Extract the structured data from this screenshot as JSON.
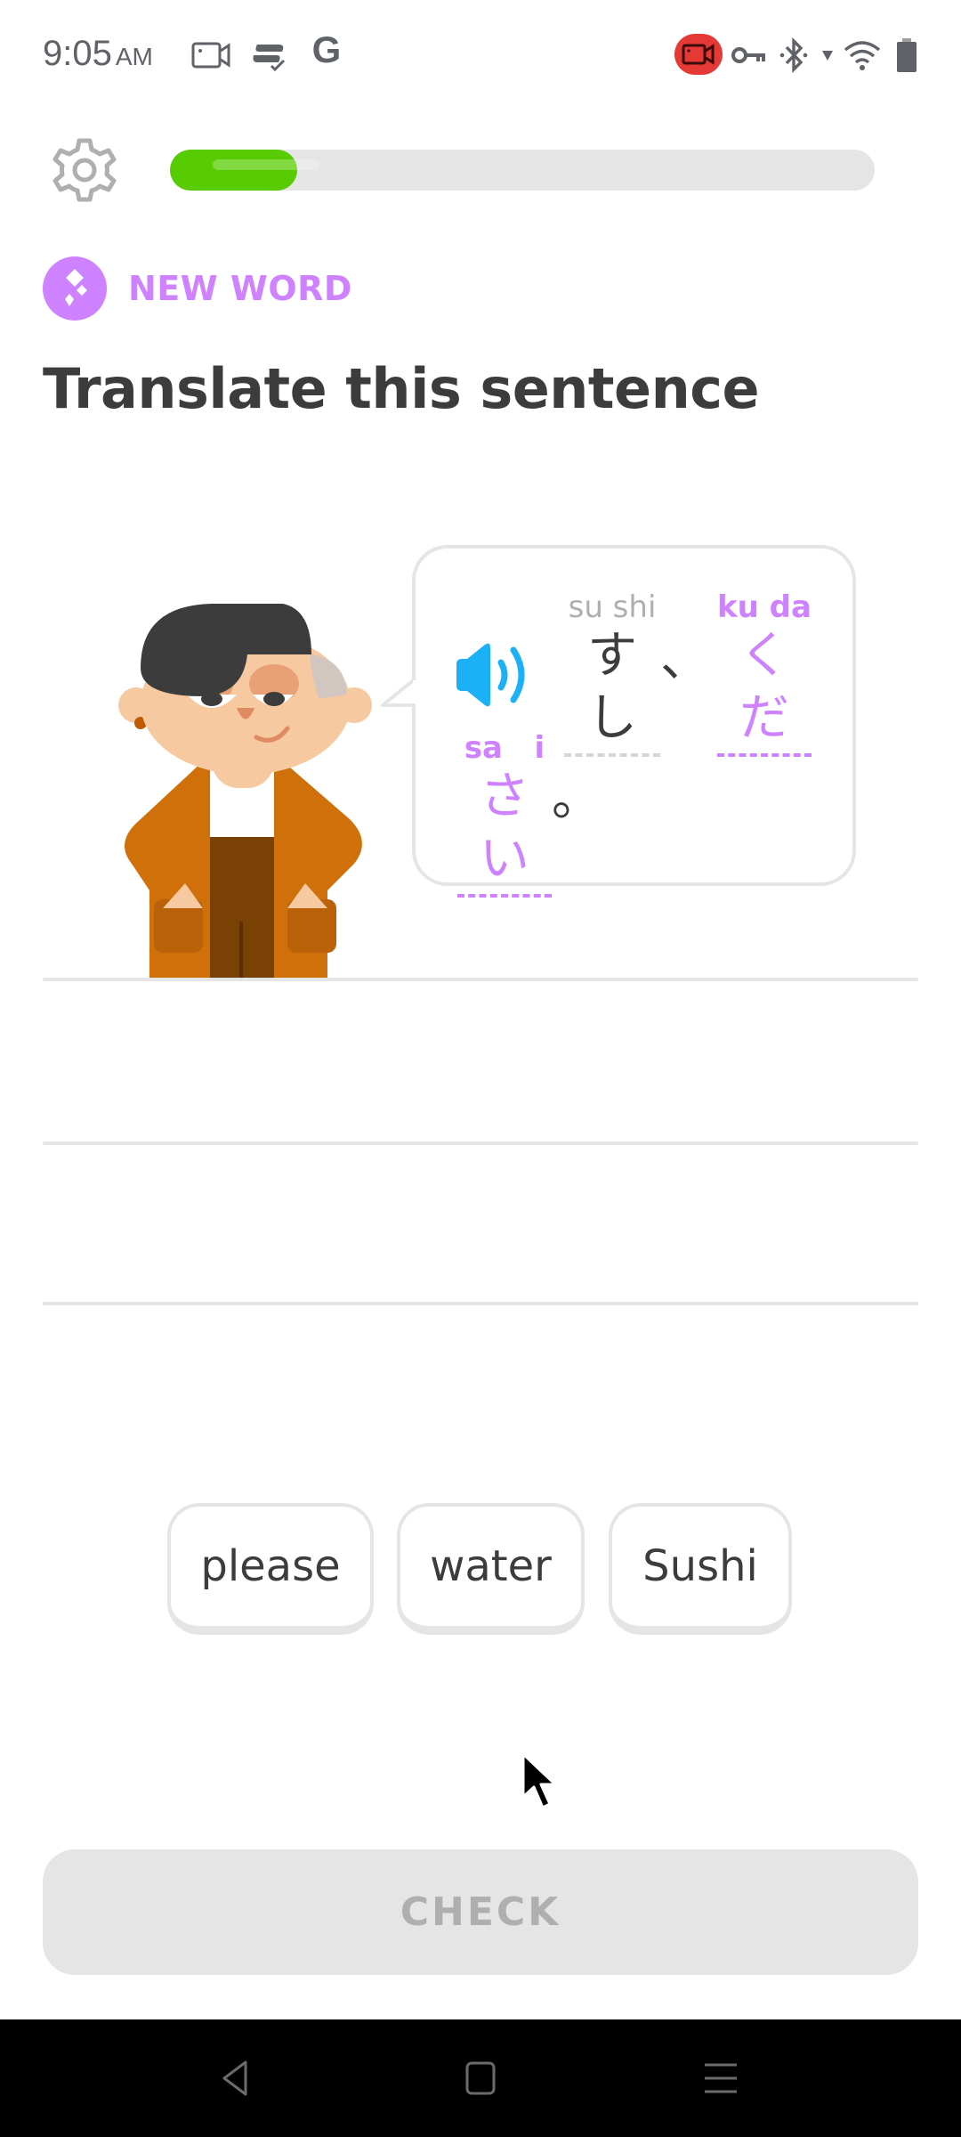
{
  "status_bar": {
    "time": "9:05",
    "ampm": "AM",
    "left_icons": [
      "screen-record-icon",
      "duo-sync-icon",
      "google-icon"
    ],
    "right_icons": [
      "recording-active-icon",
      "vpn-key-icon",
      "bluetooth-icon",
      "signal-icon",
      "wifi-icon",
      "battery-icon"
    ],
    "google_letter": "G"
  },
  "header": {
    "settings_icon": "gear-icon",
    "progress_percent": 18
  },
  "badge": {
    "label": "NEW WORD",
    "icon": "new-word-sparkle-icon"
  },
  "challenge": {
    "title": "Translate this sentence",
    "audio_icon": "speaker-icon",
    "tokens": [
      {
        "romaji": "su shi",
        "kana": "すし",
        "type": "known"
      },
      {
        "romaji": "ku da",
        "kana": "くだ",
        "type": "new"
      },
      {
        "romaji": "sa   i",
        "kana": "さい",
        "type": "new"
      }
    ],
    "punctuation": [
      "、",
      "。"
    ]
  },
  "word_bank": [
    {
      "label": "please"
    },
    {
      "label": "water"
    },
    {
      "label": "Sushi"
    }
  ],
  "check_button": {
    "label": "CHECK",
    "enabled": false
  },
  "nav_bar": {
    "buttons": [
      "back-icon",
      "home-icon",
      "recents-icon"
    ]
  },
  "colors": {
    "accent_green": "#58cc02",
    "new_word_purple": "#ce82ff",
    "speaker_blue": "#1cb0f6",
    "disabled_gray": "#e5e5e5"
  }
}
